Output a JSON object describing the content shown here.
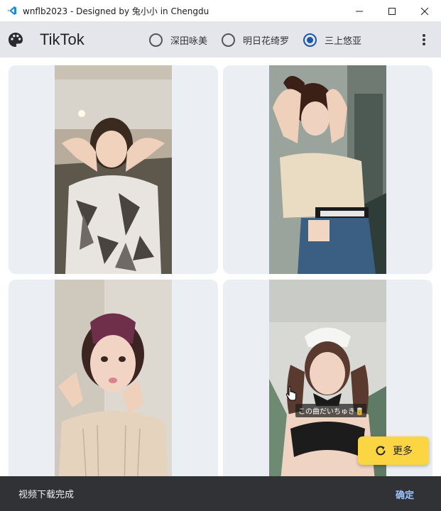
{
  "window": {
    "title": "wnflb2023 - Designed by 兔小小 in Chengdu",
    "app_icon": "vscode-icon",
    "controls": [
      "minimize-icon",
      "maximize-icon",
      "close-icon"
    ]
  },
  "appbar": {
    "icon": "palette-icon",
    "title": "TikTok",
    "options": [
      {
        "label": "深田咏美",
        "checked": false
      },
      {
        "label": "明日花绮罗",
        "checked": false
      },
      {
        "label": "三上悠亚",
        "checked": true
      }
    ],
    "menu_icon": "more-vert-icon"
  },
  "videos": [
    {
      "caption": ""
    },
    {
      "caption": ""
    },
    {
      "caption": ""
    },
    {
      "caption": "この曲だいちゅき🥫"
    }
  ],
  "fab": {
    "icon": "refresh-icon",
    "label": "更多"
  },
  "snackbar": {
    "message": "视频下载完成",
    "action": "确定"
  },
  "colors": {
    "appbar": "#e4e6ec",
    "accent": "#1e56a8",
    "fab": "#fbd542",
    "snackbar": "#303236",
    "snack_action": "#9ec3ff"
  }
}
